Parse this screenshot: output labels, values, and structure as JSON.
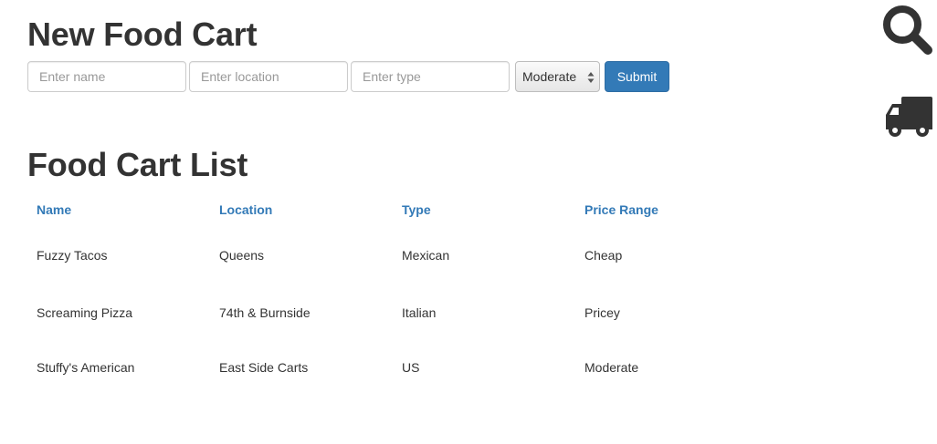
{
  "new_cart": {
    "title": "New Food Cart",
    "name_placeholder": "Enter name",
    "location_placeholder": "Enter location",
    "type_placeholder": "Enter type",
    "price_selected": "Moderate",
    "submit_label": "Submit"
  },
  "cart_list": {
    "title": "Food Cart List",
    "columns": [
      "Name",
      "Location",
      "Type",
      "Price Range"
    ],
    "rows": [
      [
        "Fuzzy Tacos",
        "Queens",
        "Mexican",
        "Cheap"
      ],
      [
        "Screaming Pizza",
        "74th & Burnside",
        "Italian",
        "Pricey"
      ],
      [
        "Stuffy's American",
        "East Side Carts",
        "US",
        "Moderate"
      ]
    ]
  },
  "icons": {
    "search": "search-icon",
    "truck": "truck-icon"
  },
  "colors": {
    "heading": "#333333",
    "link": "#337ab7",
    "button": "#337ab7",
    "icon": "#333333"
  }
}
